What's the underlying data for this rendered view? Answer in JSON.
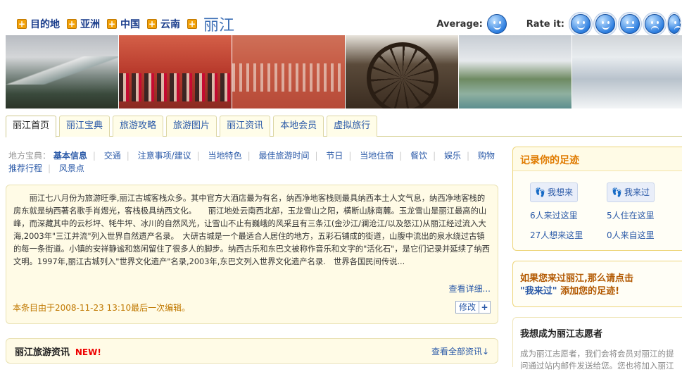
{
  "breadcrumb": {
    "items": [
      "目的地",
      "亚洲",
      "中国",
      "云南"
    ],
    "current": "丽江"
  },
  "rating": {
    "average_label": "Average:",
    "rate_label": "Rate it:"
  },
  "tabs": [
    "丽江首页",
    "丽江宝典",
    "旅游攻略",
    "旅游图片",
    "丽江资讯",
    "本地会员",
    "虚拟旅行"
  ],
  "categories": {
    "label": "地方宝典：",
    "items": [
      "基本信息",
      "交通",
      "注意事项/建议",
      "当地特色",
      "最佳旅游时间",
      "节日",
      "当地住宿",
      "餐饮",
      "娱乐",
      "购物",
      "推荐行程",
      "风景点"
    ]
  },
  "intro": {
    "text": "丽江七八月份为旅游旺季,丽江古城客栈众多。其中官方大酒店最为有名，纳西净地客栈则最具纳西本土人文气息，纳西净地客栈的房东就是纳西著名歌手肖煜光，客栈极具纳西文化。　　丽江地处云南西北部，玉龙雪山之阳，横断山脉南麓。玉龙雪山是丽江最高的山峰，而深藏其中的云杉坪、牦牛坪、冰川的自然风光，让雪山不止有巍峨的风采且有三条江(金沙江/澜沧江/以及怒江)从丽江经过流入大海,2003年\"三江并流\"列入世界自然遗产名录。　大研古城是一个最适合人居住的地方，五彩石铺成的街道，山腹中流出的泉水绕过古镇的每一条街道。小镇的安祥静谧和悠闲留住了很多人的脚步。纳西古乐和东巴文被称作音乐和文字的\"活化石\"，是它们记录并延续了纳西文明。1997年,丽江古城列入\"世界文化遗产\"名录,2003年,东巴文列入世界文化遗产名录.　世界各国民间传说...",
    "more_label": "查看详细...",
    "edited": "本条目由于2008-11-23 13:10最后一次编辑。",
    "edit_label": "修改",
    "edit_plus": "+"
  },
  "news": {
    "title": "丽江旅游资讯",
    "new_badge": "NEW!",
    "all_label": "查看全部资讯↓"
  },
  "footprints": {
    "title": "记录你的足迹",
    "want_label": "我想来",
    "been_label": "我来过",
    "stats": [
      "6人来过这里",
      "5人住在这里",
      "27人想来这里",
      "0人来自这里"
    ]
  },
  "prompt": {
    "line1": "如果您来过丽江,那么请点击",
    "highlight": "\"我来过\"",
    "line2": " 添加您的足迹!"
  },
  "volunteer": {
    "title": "我想成为丽江志愿者",
    "text": "成为丽江志愿者，我们会将会员对丽江的提问通过站内邮件发送给您。您也将加入丽江"
  },
  "colors": {
    "link": "#2b5aa8",
    "accent_orange": "#e07b00",
    "box_bg": "#fffbe6",
    "new_red": "#ee0000"
  }
}
